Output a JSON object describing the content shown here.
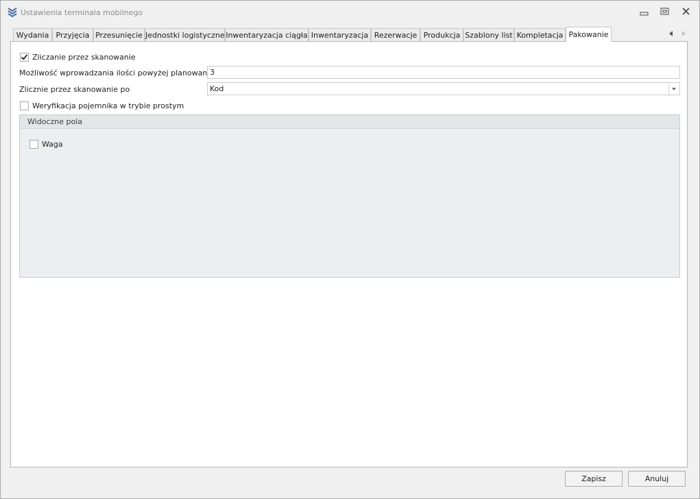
{
  "window": {
    "title": "Ustawienia terminala mobilnego"
  },
  "tabs": [
    {
      "label": "Wydania"
    },
    {
      "label": "Przyjęcia"
    },
    {
      "label": "Przesunięcie"
    },
    {
      "label": "Jednostki logistyczne"
    },
    {
      "label": "Inwentaryzacja ciągła"
    },
    {
      "label": "Inwentaryzacja"
    },
    {
      "label": "Rezerwacje"
    },
    {
      "label": "Produkcja"
    },
    {
      "label": "Szablony list"
    },
    {
      "label": "Kompletacja"
    },
    {
      "label": "Pakowanie"
    }
  ],
  "active_tab": "Pakowanie",
  "form": {
    "scan_counting": {
      "label": "Zliczanie przez skanowanie",
      "checked": true
    },
    "over_quantity": {
      "label": "Możliwość wprowadzania ilości powyżej planowanej ilości",
      "value": "3"
    },
    "scan_by": {
      "label": "Zlicznie przez skanowanie po",
      "value": "Kod"
    },
    "container_verification": {
      "label": "Weryfikacja pojemnika w trybie prostym",
      "checked": false
    }
  },
  "visible_fields": {
    "title": "Widoczne pola",
    "weight": {
      "label": "Waga",
      "checked": false
    }
  },
  "buttons": {
    "save": "Zapisz",
    "cancel": "Anuluj"
  },
  "colors": {
    "accent": "#4a6fa5",
    "panel_bg": "#ffffff",
    "window_bg": "#f0f0f0"
  }
}
